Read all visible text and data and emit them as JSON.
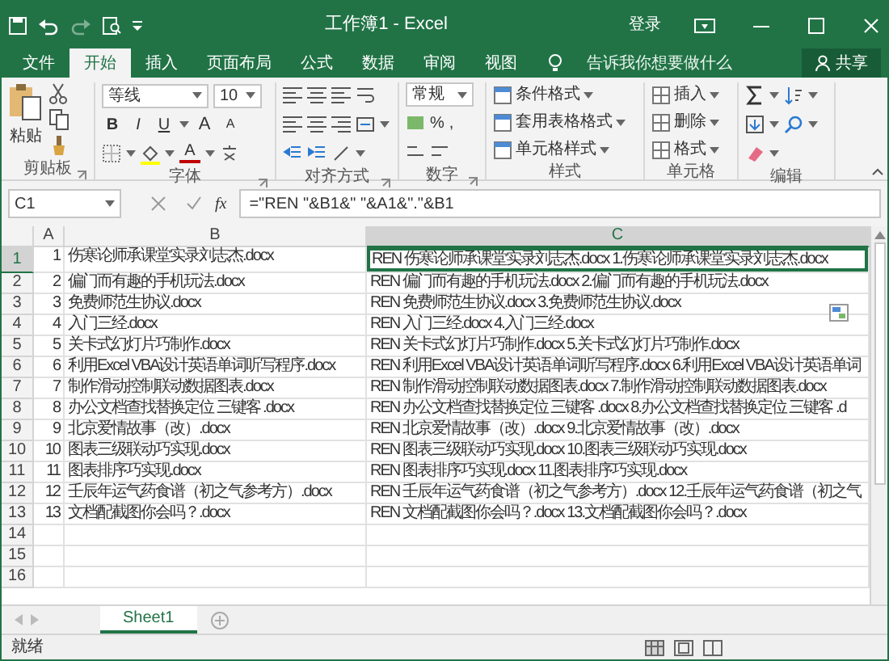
{
  "window": {
    "title": "工作簿1 - Excel",
    "sign_in": "登录"
  },
  "tabs": [
    {
      "label": "文件",
      "selected": false
    },
    {
      "label": "开始",
      "selected": true
    },
    {
      "label": "插入",
      "selected": false
    },
    {
      "label": "页面布局",
      "selected": false
    },
    {
      "label": "公式",
      "selected": false
    },
    {
      "label": "数据",
      "selected": false
    },
    {
      "label": "审阅",
      "selected": false
    },
    {
      "label": "视图",
      "selected": false
    }
  ],
  "tell_me": {
    "placeholder": "告诉我你想要做什么"
  },
  "share": "共享",
  "ribbon": {
    "clipboard": {
      "label": "剪贴板",
      "paste": "粘贴"
    },
    "font": {
      "label": "字体",
      "font_name": "等线",
      "font_size": "10",
      "bold": "B",
      "italic": "I",
      "underline": "U",
      "grow": "A",
      "shrink": "A",
      "font_color": "A"
    },
    "alignment": {
      "label": "对齐方式"
    },
    "number": {
      "label": "数字",
      "format": "常规",
      "percent": "%",
      "comma": ","
    },
    "styles": {
      "label": "样式",
      "commands": [
        "条件格式",
        "套用表格格式",
        "单元格样式"
      ]
    },
    "cells": {
      "label": "单元格",
      "commands": [
        "插入",
        "删除",
        "格式"
      ]
    },
    "editing": {
      "label": "编辑"
    }
  },
  "formula_bar": {
    "name_box": "C1",
    "function_label": "fx",
    "formula": "=\"REN \"&B1&\" \"&A1&\".\"&B1"
  },
  "columns": [
    {
      "label": "A",
      "selected": false
    },
    {
      "label": "B",
      "selected": false
    },
    {
      "label": "C",
      "selected": true
    }
  ],
  "rows": [
    {
      "header": "1",
      "selected": true,
      "a": "1",
      "b": "伤寒论师承课堂实录刘志杰.docx",
      "c": "REN 伤寒论师承课堂实录刘志杰.docx 1.伤寒论师承课堂实录刘志杰.docx"
    },
    {
      "header": "2",
      "selected": false,
      "a": "2",
      "b": "偏门而有趣的手机玩法.docx",
      "c": "REN 偏门而有趣的手机玩法.docx 2.偏门而有趣的手机玩法.docx"
    },
    {
      "header": "3",
      "selected": false,
      "a": "3",
      "b": "免费师范生协议.docx",
      "c": "REN 免费师范生协议.docx 3.免费师范生协议.docx"
    },
    {
      "header": "4",
      "selected": false,
      "a": "4",
      "b": "入门三经.docx",
      "c": "REN 入门三经.docx 4.入门三经.docx"
    },
    {
      "header": "5",
      "selected": false,
      "a": "5",
      "b": "关卡式幻灯片巧制作.docx",
      "c": "REN 关卡式幻灯片巧制作.docx 5.关卡式幻灯片巧制作.docx"
    },
    {
      "header": "6",
      "selected": false,
      "a": "6",
      "b": "利用Excel VBA设计英语单词听写程序.docx",
      "c": "REN 利用Excel VBA设计英语单词听写程序.docx 6.利用Excel VBA设计英语单词"
    },
    {
      "header": "7",
      "selected": false,
      "a": "7",
      "b": "制作滑动控制联动数据图表.docx",
      "c": "REN 制作滑动控制联动数据图表.docx 7.制作滑动控制联动数据图表.docx"
    },
    {
      "header": "8",
      "selected": false,
      "a": "8",
      "b": "办公文档查找替换定位 三键客 .docx",
      "c": "REN 办公文档查找替换定位 三键客 .docx 8.办公文档查找替换定位 三键客 .d"
    },
    {
      "header": "9",
      "selected": false,
      "a": "9",
      "b": "北京爱情故事（改）.docx",
      "c": "REN 北京爱情故事（改）.docx 9.北京爱情故事（改）.docx"
    },
    {
      "header": "10",
      "selected": false,
      "a": "10",
      "b": "图表三级联动巧实现.docx",
      "c": "REN 图表三级联动巧实现.docx 10.图表三级联动巧实现.docx"
    },
    {
      "header": "11",
      "selected": false,
      "a": "11",
      "b": "图表排序巧实现.docx",
      "c": "REN 图表排序巧实现.docx 11.图表排序巧实现.docx"
    },
    {
      "header": "12",
      "selected": false,
      "a": "12",
      "b": "壬辰年运气药食谱（初之气参考方）.docx",
      "c": "REN 壬辰年运气药食谱（初之气参考方）.docx 12.壬辰年运气药食谱（初之气"
    },
    {
      "header": "13",
      "selected": false,
      "a": "13",
      "b": "文档配截图你会吗？.docx",
      "c": "REN 文档配截图你会吗？.docx 13.文档配截图你会吗？.docx"
    },
    {
      "header": "14",
      "selected": false
    },
    {
      "header": "15",
      "selected": false
    },
    {
      "header": "16",
      "selected": false
    }
  ],
  "sheets": [
    {
      "label": "Sheet1",
      "selected": true
    }
  ],
  "status_bar": {
    "text": "就绪"
  }
}
